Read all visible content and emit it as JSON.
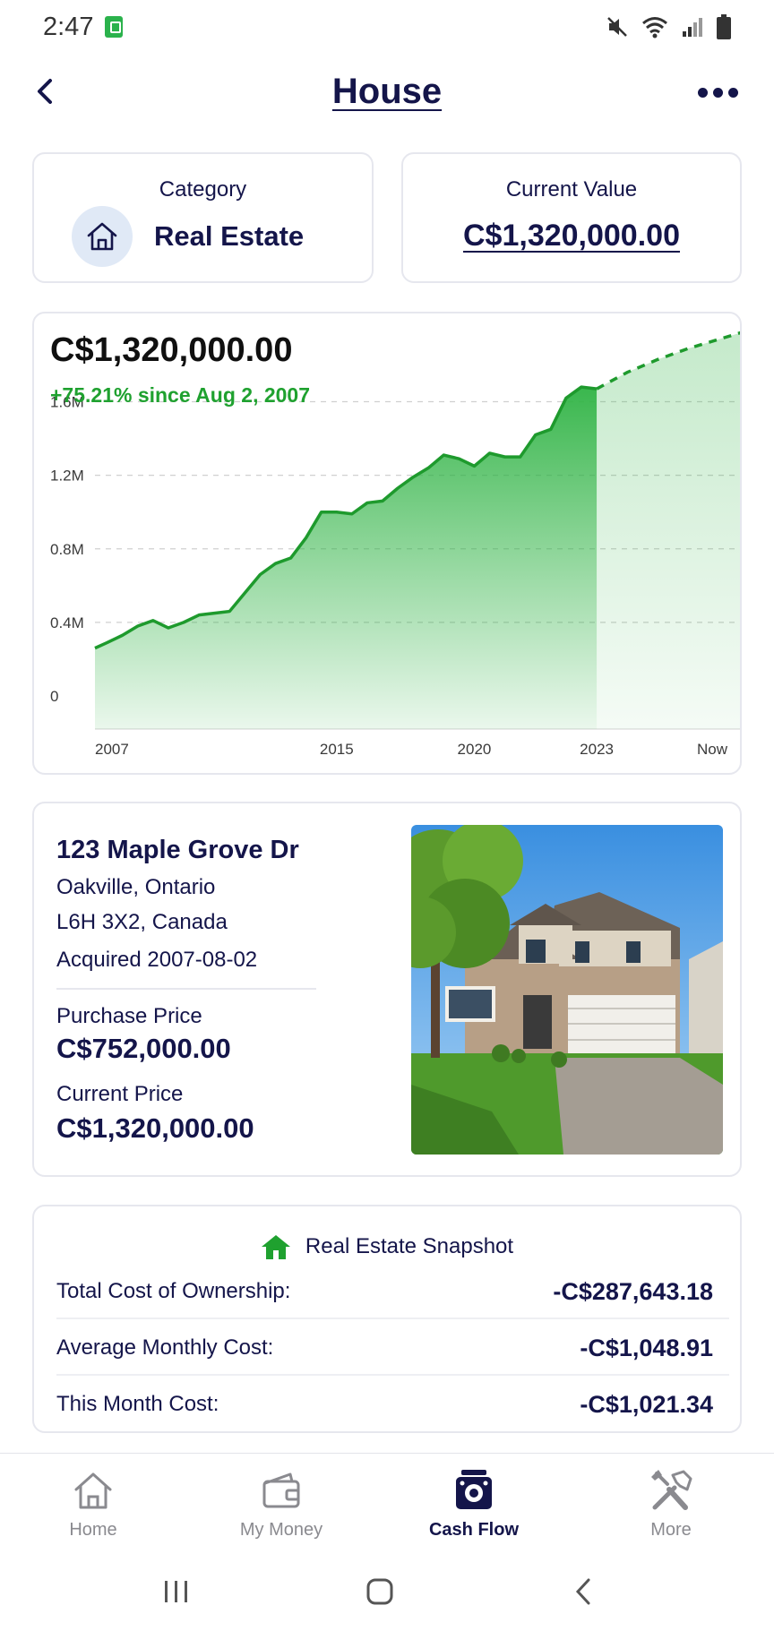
{
  "status_bar": {
    "time": "2:47"
  },
  "header": {
    "title": "House"
  },
  "category_card": {
    "label": "Category",
    "value": "Real Estate"
  },
  "value_card": {
    "label": "Current Value",
    "value": "C$1,320,000.00"
  },
  "chart_data": {
    "type": "area",
    "title": "C$1,320,000.00",
    "subtitle": "+75.21% since Aug 2, 2007",
    "ylim": [
      0,
      1700000
    ],
    "y_ticks": [
      "0",
      "0.4M",
      "0.8M",
      "1.2M",
      "1.6M"
    ],
    "y_tick_values": [
      0,
      400000,
      800000,
      1200000,
      1600000
    ],
    "x_ticks": [
      "2007",
      "2015",
      "2020",
      "2023",
      "Now"
    ],
    "x_tick_values": [
      2007.6,
      2015.5,
      2020,
      2024,
      2028.8
    ],
    "grid": true,
    "series": [
      {
        "style": "solid",
        "x": [
          2007.6,
          2008.0,
          2008.5,
          2009.0,
          2009.5,
          2010.0,
          2010.5,
          2011.0,
          2011.5,
          2012.0,
          2012.5,
          2013.0,
          2013.5,
          2014.0,
          2014.5,
          2015.0,
          2015.5,
          2016.0,
          2016.5,
          2017.0,
          2017.5,
          2018.0,
          2018.5,
          2019.0,
          2019.5,
          2020.0,
          2020.5,
          2021.0,
          2021.5,
          2022.0,
          2022.5,
          2023.0,
          2023.5,
          2024.0
        ],
        "values": [
          260000,
          290000,
          330000,
          380000,
          410000,
          370000,
          400000,
          440000,
          450000,
          460000,
          560000,
          660000,
          720000,
          750000,
          860000,
          1000000,
          1000000,
          990000,
          1050000,
          1060000,
          1130000,
          1190000,
          1240000,
          1310000,
          1290000,
          1250000,
          1320000,
          1300000,
          1300000,
          1420000,
          1450000,
          1620000,
          1680000,
          1670000
        ]
      },
      {
        "style": "dashed",
        "x": [
          2024.0,
          2025.0,
          2026.0,
          2027.0,
          2028.0,
          2028.8
        ],
        "values": [
          1670000,
          1760000,
          1830000,
          1890000,
          1940000,
          1980000
        ]
      }
    ]
  },
  "property": {
    "address": "123 Maple Grove Dr",
    "city": "Oakville, Ontario",
    "postal": "L6H 3X2, Canada",
    "acquired": "Acquired 2007-08-02",
    "purchase_label": "Purchase Price",
    "purchase_value": "C$752,000.00",
    "current_label": "Current Price",
    "current_value": "C$1,320,000.00"
  },
  "snapshot": {
    "title": "Real Estate Snapshot",
    "rows": [
      {
        "label": "Total Cost of Ownership:",
        "value": "-C$287,643.18"
      },
      {
        "label": "Average Monthly Cost:",
        "value": "-C$1,048.91"
      },
      {
        "label": "This Month Cost:",
        "value": "-C$1,021.34"
      }
    ]
  },
  "bottom_nav": {
    "items": [
      {
        "label": "Home",
        "icon": "home-icon"
      },
      {
        "label": "My Money",
        "icon": "wallet-icon"
      },
      {
        "label": "Cash Flow",
        "icon": "cash-flow-icon"
      },
      {
        "label": "More",
        "icon": "tools-icon"
      }
    ]
  },
  "colors": {
    "navy": "#14154a",
    "green": "#1fa12f",
    "area_green": "#2fb344"
  }
}
